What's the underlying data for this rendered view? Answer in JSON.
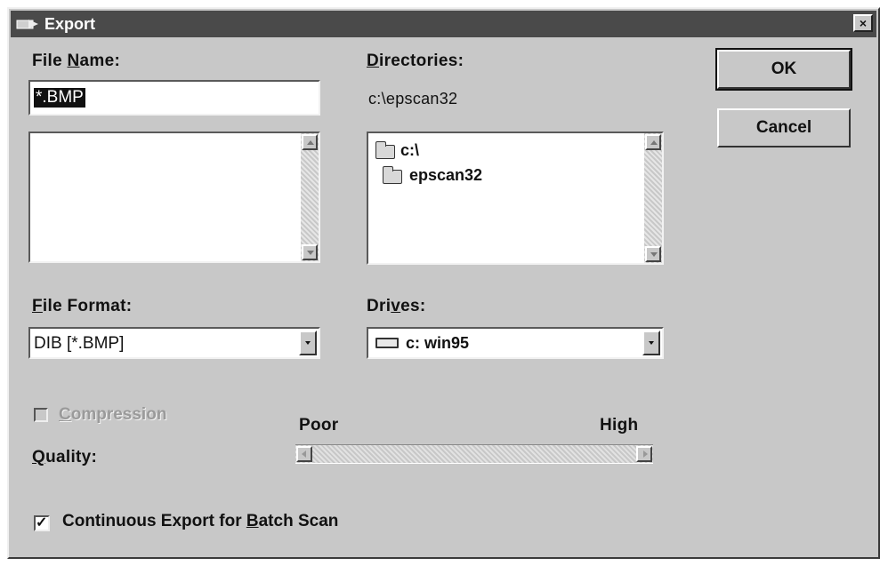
{
  "window": {
    "title": "Export",
    "close_glyph": "×"
  },
  "file_name": {
    "label_pre": "File ",
    "label_u": "N",
    "label_post": "ame:",
    "value": "*.BMP"
  },
  "directories": {
    "label_u": "D",
    "label_post": "irectories:",
    "path": "c:\\epscan32",
    "items": [
      {
        "label": "c:\\"
      },
      {
        "label": "epscan32"
      }
    ]
  },
  "buttons": {
    "ok": "OK",
    "cancel": "Cancel"
  },
  "file_format": {
    "label_u": "F",
    "label_post": "ile Format:",
    "value": "DIB [*.BMP]"
  },
  "drives": {
    "label_pre": "Dri",
    "label_u": "v",
    "label_post": "es:",
    "value": "c: win95"
  },
  "compression": {
    "label_u": "C",
    "label_post": "ompression",
    "checked": false,
    "enabled": false
  },
  "quality": {
    "label_u": "Q",
    "label_post": "uality:",
    "min_label": "Poor",
    "max_label": "High",
    "enabled": false
  },
  "continuous": {
    "label_pre": "Continuous Export for ",
    "label_u": "B",
    "label_post": "atch Scan",
    "checked": true,
    "check_glyph": "✓"
  },
  "icons": [
    "folder-open-icon",
    "drive-icon",
    "scroll-up-arrow-icon",
    "scroll-down-arrow-icon",
    "dropdown-arrow-icon",
    "app-icon",
    "close-icon"
  ]
}
